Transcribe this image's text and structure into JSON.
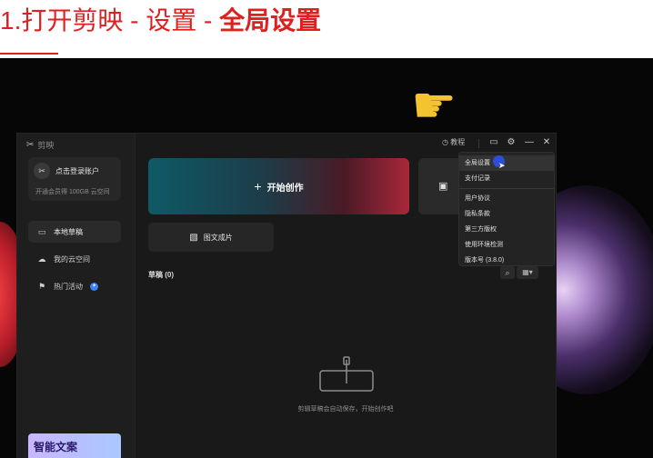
{
  "header": {
    "title_plain": "1.打开剪映 - 设置 - ",
    "title_bold": "全局设置"
  },
  "app": {
    "logo": "剪映",
    "account": {
      "login_label": "点击登录账户",
      "space_promo": "开通会员得 100GB 云空间"
    },
    "sidebar": {
      "items": [
        {
          "label": "本地草稿",
          "icon": "folder-icon"
        },
        {
          "label": "我的云空间",
          "icon": "cloud-icon"
        },
        {
          "label": "热门活动",
          "icon": "flag-icon",
          "badge": "✦"
        }
      ],
      "promo_banner": "智能文案"
    },
    "titlebar": {
      "help_label": "教程"
    },
    "main": {
      "create_label": "开始创作",
      "image_to_video_label": "图文成片",
      "drafts_title": "草稿 (0)",
      "empty_text": "剪辑草稿会自动保存，开始创作吧"
    },
    "menu": {
      "items": [
        "全局设置",
        "支付记录",
        "用户协议",
        "隐私条款",
        "第三方版权",
        "使用环境检测",
        "版本号 (3.8.0)"
      ]
    }
  }
}
